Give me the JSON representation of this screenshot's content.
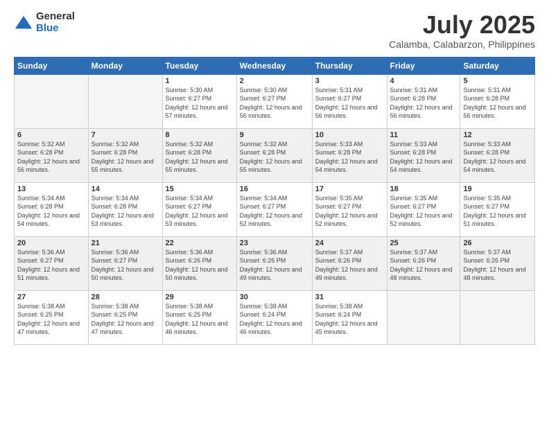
{
  "logo": {
    "general": "General",
    "blue": "Blue"
  },
  "title": "July 2025",
  "subtitle": "Calamba, Calabarzon, Philippines",
  "days_header": [
    "Sunday",
    "Monday",
    "Tuesday",
    "Wednesday",
    "Thursday",
    "Friday",
    "Saturday"
  ],
  "weeks": [
    [
      {
        "day": "",
        "empty": true
      },
      {
        "day": "",
        "empty": true
      },
      {
        "day": "1",
        "sunrise": "Sunrise: 5:30 AM",
        "sunset": "Sunset: 6:27 PM",
        "daylight": "Daylight: 12 hours and 57 minutes."
      },
      {
        "day": "2",
        "sunrise": "Sunrise: 5:30 AM",
        "sunset": "Sunset: 6:27 PM",
        "daylight": "Daylight: 12 hours and 56 minutes."
      },
      {
        "day": "3",
        "sunrise": "Sunrise: 5:31 AM",
        "sunset": "Sunset: 6:27 PM",
        "daylight": "Daylight: 12 hours and 56 minutes."
      },
      {
        "day": "4",
        "sunrise": "Sunrise: 5:31 AM",
        "sunset": "Sunset: 6:28 PM",
        "daylight": "Daylight: 12 hours and 56 minutes."
      },
      {
        "day": "5",
        "sunrise": "Sunrise: 5:31 AM",
        "sunset": "Sunset: 6:28 PM",
        "daylight": "Daylight: 12 hours and 56 minutes."
      }
    ],
    [
      {
        "day": "6",
        "sunrise": "Sunrise: 5:32 AM",
        "sunset": "Sunset: 6:28 PM",
        "daylight": "Daylight: 12 hours and 56 minutes."
      },
      {
        "day": "7",
        "sunrise": "Sunrise: 5:32 AM",
        "sunset": "Sunset: 6:28 PM",
        "daylight": "Daylight: 12 hours and 55 minutes."
      },
      {
        "day": "8",
        "sunrise": "Sunrise: 5:32 AM",
        "sunset": "Sunset: 6:28 PM",
        "daylight": "Daylight: 12 hours and 55 minutes."
      },
      {
        "day": "9",
        "sunrise": "Sunrise: 5:32 AM",
        "sunset": "Sunset: 6:28 PM",
        "daylight": "Daylight: 12 hours and 55 minutes."
      },
      {
        "day": "10",
        "sunrise": "Sunrise: 5:33 AM",
        "sunset": "Sunset: 6:28 PM",
        "daylight": "Daylight: 12 hours and 54 minutes."
      },
      {
        "day": "11",
        "sunrise": "Sunrise: 5:33 AM",
        "sunset": "Sunset: 6:28 PM",
        "daylight": "Daylight: 12 hours and 54 minutes."
      },
      {
        "day": "12",
        "sunrise": "Sunrise: 5:33 AM",
        "sunset": "Sunset: 6:28 PM",
        "daylight": "Daylight: 12 hours and 54 minutes."
      }
    ],
    [
      {
        "day": "13",
        "sunrise": "Sunrise: 5:34 AM",
        "sunset": "Sunset: 6:28 PM",
        "daylight": "Daylight: 12 hours and 54 minutes."
      },
      {
        "day": "14",
        "sunrise": "Sunrise: 5:34 AM",
        "sunset": "Sunset: 6:28 PM",
        "daylight": "Daylight: 12 hours and 53 minutes."
      },
      {
        "day": "15",
        "sunrise": "Sunrise: 5:34 AM",
        "sunset": "Sunset: 6:27 PM",
        "daylight": "Daylight: 12 hours and 53 minutes."
      },
      {
        "day": "16",
        "sunrise": "Sunrise: 5:34 AM",
        "sunset": "Sunset: 6:27 PM",
        "daylight": "Daylight: 12 hours and 52 minutes."
      },
      {
        "day": "17",
        "sunrise": "Sunrise: 5:35 AM",
        "sunset": "Sunset: 6:27 PM",
        "daylight": "Daylight: 12 hours and 52 minutes."
      },
      {
        "day": "18",
        "sunrise": "Sunrise: 5:35 AM",
        "sunset": "Sunset: 6:27 PM",
        "daylight": "Daylight: 12 hours and 52 minutes."
      },
      {
        "day": "19",
        "sunrise": "Sunrise: 5:35 AM",
        "sunset": "Sunset: 6:27 PM",
        "daylight": "Daylight: 12 hours and 51 minutes."
      }
    ],
    [
      {
        "day": "20",
        "sunrise": "Sunrise: 5:36 AM",
        "sunset": "Sunset: 6:27 PM",
        "daylight": "Daylight: 12 hours and 51 minutes."
      },
      {
        "day": "21",
        "sunrise": "Sunrise: 5:36 AM",
        "sunset": "Sunset: 6:27 PM",
        "daylight": "Daylight: 12 hours and 50 minutes."
      },
      {
        "day": "22",
        "sunrise": "Sunrise: 5:36 AM",
        "sunset": "Sunset: 6:26 PM",
        "daylight": "Daylight: 12 hours and 50 minutes."
      },
      {
        "day": "23",
        "sunrise": "Sunrise: 5:36 AM",
        "sunset": "Sunset: 6:26 PM",
        "daylight": "Daylight: 12 hours and 49 minutes."
      },
      {
        "day": "24",
        "sunrise": "Sunrise: 5:37 AM",
        "sunset": "Sunset: 6:26 PM",
        "daylight": "Daylight: 12 hours and 49 minutes."
      },
      {
        "day": "25",
        "sunrise": "Sunrise: 5:37 AM",
        "sunset": "Sunset: 6:26 PM",
        "daylight": "Daylight: 12 hours and 48 minutes."
      },
      {
        "day": "26",
        "sunrise": "Sunrise: 5:37 AM",
        "sunset": "Sunset: 6:26 PM",
        "daylight": "Daylight: 12 hours and 48 minutes."
      }
    ],
    [
      {
        "day": "27",
        "sunrise": "Sunrise: 5:38 AM",
        "sunset": "Sunset: 6:25 PM",
        "daylight": "Daylight: 12 hours and 47 minutes."
      },
      {
        "day": "28",
        "sunrise": "Sunrise: 5:38 AM",
        "sunset": "Sunset: 6:25 PM",
        "daylight": "Daylight: 12 hours and 47 minutes."
      },
      {
        "day": "29",
        "sunrise": "Sunrise: 5:38 AM",
        "sunset": "Sunset: 6:25 PM",
        "daylight": "Daylight: 12 hours and 46 minutes."
      },
      {
        "day": "30",
        "sunrise": "Sunrise: 5:38 AM",
        "sunset": "Sunset: 6:24 PM",
        "daylight": "Daylight: 12 hours and 46 minutes."
      },
      {
        "day": "31",
        "sunrise": "Sunrise: 5:38 AM",
        "sunset": "Sunset: 6:24 PM",
        "daylight": "Daylight: 12 hours and 45 minutes."
      },
      {
        "day": "",
        "empty": true
      },
      {
        "day": "",
        "empty": true
      }
    ]
  ]
}
